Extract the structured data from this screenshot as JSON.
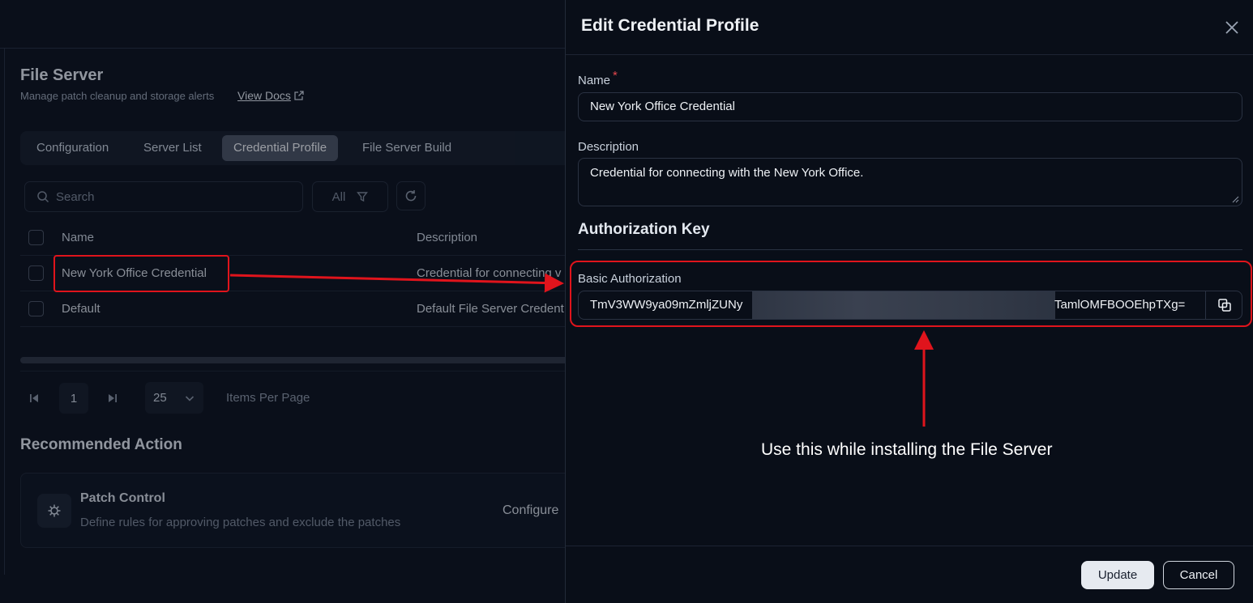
{
  "page": {
    "title": "File Server",
    "subtitle": "Manage patch cleanup and storage alerts",
    "view_docs": "View Docs"
  },
  "tabs": [
    {
      "label": "Configuration",
      "active": false
    },
    {
      "label": "Server List",
      "active": false
    },
    {
      "label": "Credential Profile",
      "active": true
    },
    {
      "label": "File Server Build",
      "active": false
    }
  ],
  "toolbar": {
    "search_placeholder": "Search",
    "filter_label": "All"
  },
  "table": {
    "columns": [
      "Name",
      "Description"
    ],
    "rows": [
      {
        "name": "New York Office Credential",
        "description": "Credential for connecting v"
      },
      {
        "name": "Default",
        "description": "Default File Server Credent"
      }
    ]
  },
  "pagination": {
    "page": "1",
    "page_size": "25",
    "per_page_label": "Items Per Page"
  },
  "recommended": {
    "title": "Recommended Action",
    "card_title": "Patch Control",
    "card_desc": "Define rules for approving patches and exclude the patches",
    "card_action": "Configure"
  },
  "drawer": {
    "title": "Edit Credential Profile",
    "name_label": "Name",
    "required_mark": "*",
    "name_value": "New York Office Credential",
    "description_label": "Description",
    "description_value": "Credential for connecting with the New York Office.",
    "section_title": "Authorization Key",
    "auth_label": "Basic Authorization",
    "auth_prefix": "TmV3WW9ya09mZmljZUNy",
    "auth_suffix": "TamlOMFBOOEhpTXg=",
    "update_label": "Update",
    "cancel_label": "Cancel"
  },
  "annotation": {
    "note": "Use this while installing the File Server",
    "color": "#e0141c"
  }
}
